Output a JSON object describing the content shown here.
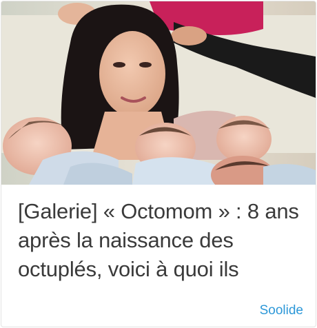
{
  "article": {
    "title": "[Galerie] « Octomom » : 8 ans après la naissance des octuplés, voici à quoi ils",
    "source": "Soolide",
    "source_color": "#2d98d8",
    "image_icon": "photo-mother-with-babies"
  }
}
